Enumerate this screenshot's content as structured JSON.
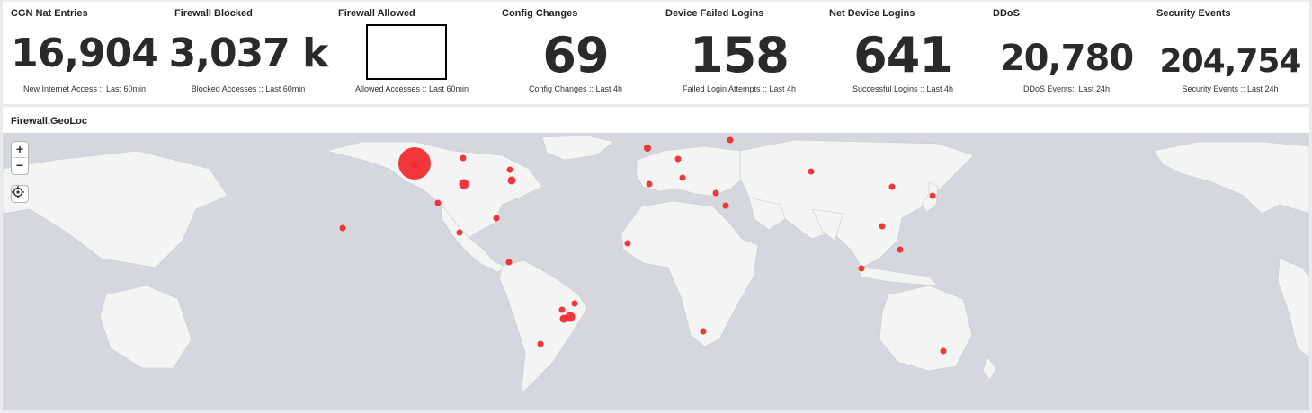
{
  "metrics": [
    {
      "title": "CGN Nat Entries",
      "value": "16,904",
      "subtitle": "New Internet Access :: Last 60min"
    },
    {
      "title": "Firewall Blocked",
      "value": "3,037 k",
      "subtitle": "Blocked Accesses :: Last 60min"
    },
    {
      "title": "Firewall Allowed",
      "value": "",
      "subtitle": "Allowed Accesses :: Last 60min"
    },
    {
      "title": "Config Changes",
      "value": "69",
      "subtitle": "Config Changes :: Last 4h"
    },
    {
      "title": "Device Failed Logins",
      "value": "158",
      "subtitle": "Failed Login Attempts :: Last 4h"
    },
    {
      "title": "Net Device Logins",
      "value": "641",
      "subtitle": "Successful Logins :: Last 4h"
    },
    {
      "title": "DDoS",
      "value": "20,780",
      "subtitle": "DDoS Events:: Last 24h"
    },
    {
      "title": "Security Events",
      "value": "204,754",
      "subtitle": "Security Events :: Last 24h"
    }
  ],
  "map_panel": {
    "title": "Firewall.GeoLoc",
    "zoom_in": "+",
    "zoom_out": "−"
  },
  "colors": {
    "marker": "#f0262a",
    "land": "#f4f4f4",
    "water": "#d4d7dc"
  }
}
